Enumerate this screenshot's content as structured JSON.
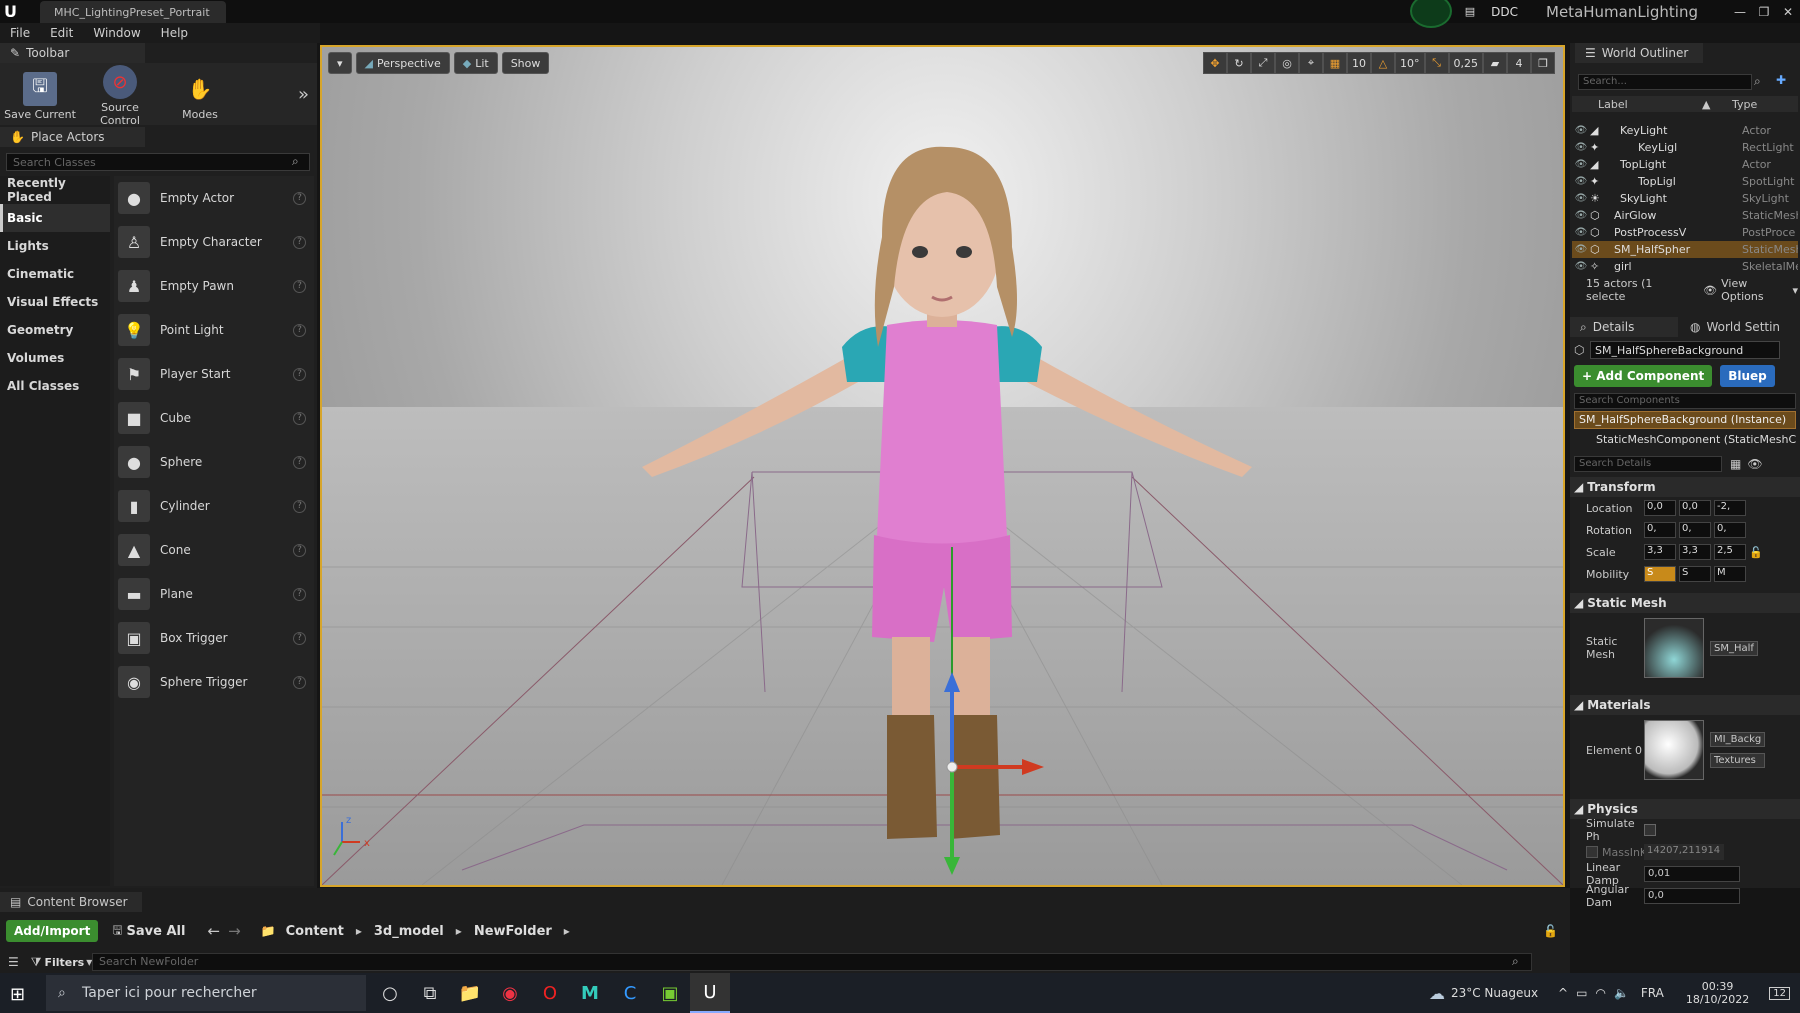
{
  "titlebar": {
    "doc_tab": "MHC_LightingPreset_Portrait",
    "ddc": "DDC",
    "project": "MetaHumanLighting"
  },
  "menu": [
    "File",
    "Edit",
    "Window",
    "Help"
  ],
  "toolbar": {
    "tab": "Toolbar",
    "save_current": "Save Current",
    "source_control": "Source Control",
    "modes": "Modes"
  },
  "place_actors": {
    "tab": "Place Actors",
    "search_placeholder": "Search Classes",
    "categories": [
      "Recently Placed",
      "Basic",
      "Lights",
      "Cinematic",
      "Visual Effects",
      "Geometry",
      "Volumes",
      "All Classes"
    ],
    "active_category": "Basic",
    "actors": [
      "Empty Actor",
      "Empty Character",
      "Empty Pawn",
      "Point Light",
      "Player Start",
      "Cube",
      "Sphere",
      "Cylinder",
      "Cone",
      "Plane",
      "Box Trigger",
      "Sphere Trigger"
    ]
  },
  "viewport": {
    "perspective": "Perspective",
    "lit": "Lit",
    "show": "Show",
    "grid_snap": "10",
    "rot_snap": "10°",
    "scale_snap": "0,25",
    "cam_speed": "4"
  },
  "outliner": {
    "tab": "World Outliner",
    "search_placeholder": "Search...",
    "col_label": "Label",
    "col_type": "Type",
    "rows": [
      {
        "label": "KeyLight",
        "type": "Actor"
      },
      {
        "label": "KeyLigl",
        "type": "RectLight"
      },
      {
        "label": "TopLight",
        "type": "Actor"
      },
      {
        "label": "TopLigl",
        "type": "SpotLight"
      },
      {
        "label": "SkyLight",
        "type": "SkyLight"
      },
      {
        "label": "AirGlow",
        "type": "StaticMesh"
      },
      {
        "label": "PostProcessV",
        "type": "PostProce"
      },
      {
        "label": "SM_HalfSpher",
        "type": "StaticMesh"
      },
      {
        "label": "girl",
        "type": "SkeletalMe"
      }
    ],
    "footer": "15 actors (1 selecte",
    "view_options": "View Options"
  },
  "details": {
    "tab": "Details",
    "tab2": "World Settin",
    "object_name": "SM_HalfSphereBackground",
    "add_component": "+ Add Component",
    "blueprint": "Bluep",
    "search_components": "Search Components",
    "instance": "SM_HalfSphereBackground (Instance)",
    "component": "StaticMeshComponent (StaticMeshC",
    "search_details": "Search Details",
    "transform": "Transform",
    "location": "Location",
    "location_vals": [
      "0,0",
      "0,0",
      "-2,"
    ],
    "rotation": "Rotation",
    "rotation_vals": [
      "0,",
      "0,",
      "0,"
    ],
    "scale": "Scale",
    "scale_vals": [
      "3,3",
      "3,3",
      "2,5"
    ],
    "mobility": "Mobility",
    "mobility_vals": [
      "S",
      "S",
      "M"
    ],
    "static_mesh_sec": "Static Mesh",
    "static_mesh_lbl": "Static Mesh",
    "static_mesh_val": "SM_Half",
    "materials_sec": "Materials",
    "element0": "Element 0",
    "material_val": "MI_Backg",
    "textures": "Textures",
    "physics_sec": "Physics",
    "simulate": "Simulate Ph",
    "mass": "MassInK",
    "mass_val": "14207,211914",
    "linear_damp": "Linear Damp",
    "linear_val": "0,01",
    "angular_damp": "Angular Dam",
    "angular_val": "0,0"
  },
  "content_browser": {
    "tab": "Content Browser",
    "add_import": "Add/Import",
    "save_all": "Save All",
    "path": [
      "Content",
      "3d_model",
      "NewFolder"
    ],
    "filters": "Filters",
    "search_placeholder": "Search NewFolder"
  },
  "taskbar": {
    "search": "Taper ici pour rechercher",
    "weather": "23°C  Nuageux",
    "lang": "FRA",
    "time": "00:39",
    "date": "18/10/2022",
    "notif": "12"
  }
}
